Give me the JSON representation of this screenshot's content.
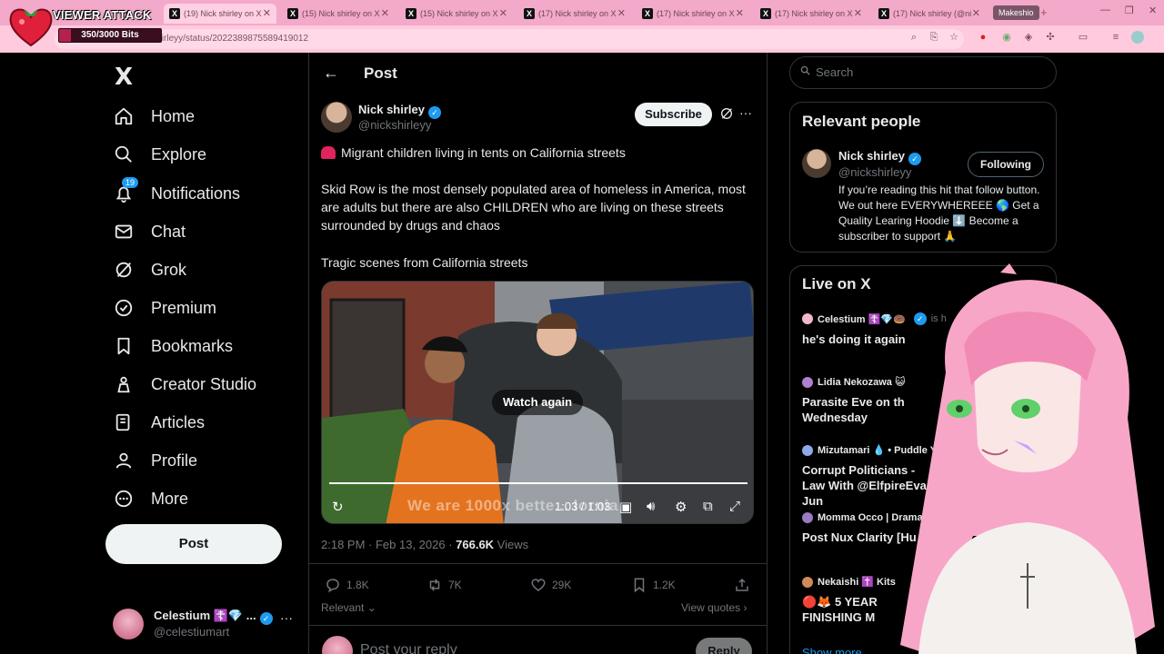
{
  "browser": {
    "tabs": [
      {
        "label": "(19) Nick shirley on X: ..."
      },
      {
        "label": "(15) Nick shirley on X: ..."
      },
      {
        "label": "(15) Nick shirley on X: ..."
      },
      {
        "label": "(17) Nick shirley on X: ..."
      },
      {
        "label": "(17) Nick shirley on X: ..."
      },
      {
        "label": "(17) Nick shirley on X: ..."
      },
      {
        "label": "(17) Nick shirley (@ni..."
      }
    ],
    "profile_label": "Makeshio",
    "url": "x.com/nickshirleyy/status/2022389875589419012"
  },
  "overlay": {
    "title": "VIEWER ATTACK",
    "bits": "350/3000 Bits",
    "progress": 0.1167
  },
  "nav": {
    "logo": "X",
    "items": [
      {
        "label": "Home"
      },
      {
        "label": "Explore"
      },
      {
        "label": "Notifications",
        "badge": "19"
      },
      {
        "label": "Chat"
      },
      {
        "label": "Grok"
      },
      {
        "label": "Premium"
      },
      {
        "label": "Bookmarks"
      },
      {
        "label": "Creator Studio"
      },
      {
        "label": "Articles"
      },
      {
        "label": "Profile"
      },
      {
        "label": "More"
      }
    ],
    "post_label": "Post",
    "account": {
      "name": "Celestium ☦️💎 ...",
      "handle": "@celestiumart",
      "more": "···"
    }
  },
  "main": {
    "header_title": "Post",
    "author": {
      "name": "Nick shirley",
      "handle": "@nickshirleyy"
    },
    "subscribe_label": "Subscribe",
    "lines": [
      "Migrant children living in tents on California streets",
      "Skid Row is the most densely populated area of homeless in America, most are adults but there are also CHILDREN who are living on these streets surrounded by drugs and chaos",
      "Tragic scenes from California streets"
    ],
    "video": {
      "watch_again": "Watch again",
      "time": "1:03 / 1:03",
      "caption": "We are 1000x bette... lornia",
      "progress": 1.0
    },
    "meta": {
      "time": "2:18 PM · Feb 13, 2026 · ",
      "views_count": "766.6K",
      "views_label": " Views"
    },
    "stats": {
      "replies": "1.8K",
      "reposts": "7K",
      "likes": "29K",
      "bookmarks": "1.2K"
    },
    "sort_label": "Relevant",
    "view_quotes": "View quotes",
    "reply_placeholder": "Post your reply",
    "reply_label": "Reply"
  },
  "right": {
    "search_placeholder": "Search",
    "relevant_title": "Relevant people",
    "person": {
      "name": "Nick shirley",
      "handle": "@nickshirleyy",
      "follow_label": "Following",
      "bio": "If you’re reading this hit that follow button. We out here EVERYWHEREEE 🌎 Get a Quality Learing Hoodie ⬇️ Become a subscriber to support 🙏"
    },
    "live_title": "Live on X",
    "live": [
      {
        "host": "Celestium ☦️💎🍩",
        "suffix": "is h",
        "title": "he's doing it again",
        "color": "#f3b8c8"
      },
      {
        "host": "Lidia Nekozawa 😺",
        "suffix": "",
        "title": "Parasite Eve on th Wednesday",
        "color": "#b07fd0"
      },
      {
        "host": "Mizutamari 💧 • Puddle Y",
        "suffix": "",
        "title": "Corrupt Politicians - Law With @ElfpireEva : Jun",
        "color": "#8fa8e8"
      },
      {
        "host": "Momma Occo | Drama",
        "suffix": "",
        "title": "Post Nux Clarity [Hu",
        "color": "#9a7ac0"
      },
      {
        "host": "Nekaishi ✝️ Kits",
        "suffix": "",
        "title": "🔴🦊 5 YEAR FINISHING M",
        "color": "#d08a5a"
      }
    ],
    "show_more": "Show more"
  }
}
